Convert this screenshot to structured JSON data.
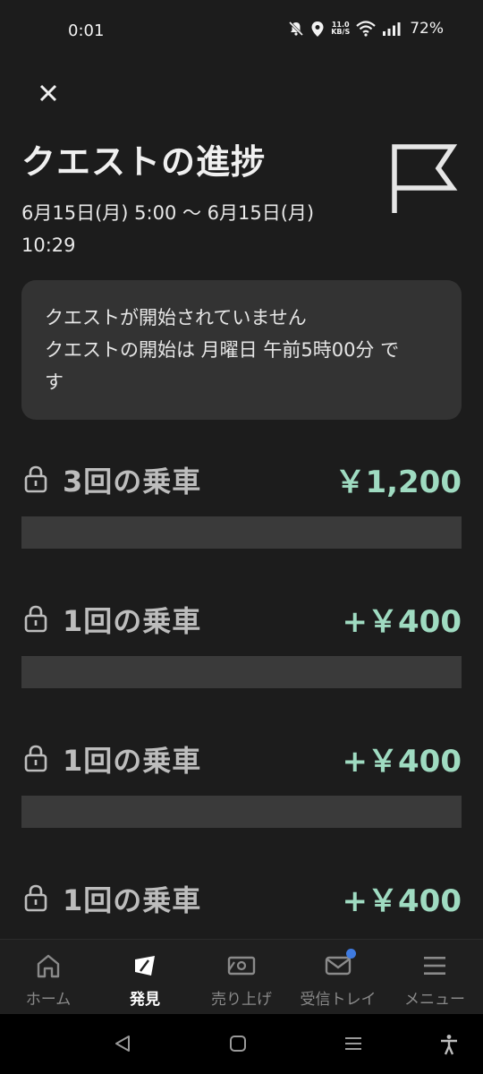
{
  "status_bar": {
    "time": "0:01",
    "net_speed_value": "11.0",
    "net_speed_unit": "KB/S",
    "battery": "72%"
  },
  "header": {
    "title": "クエストの進捗",
    "date_range_line1": "6月15日(月) 5:00 〜 6月15日(月)",
    "date_range_line2": "10:29"
  },
  "notice": {
    "line1": "クエストが開始されていません",
    "line2": "クエストの開始は 月曜日 午前5時00分 で",
    "line3": "す"
  },
  "quests": [
    {
      "label": "3回の乗車",
      "reward": "￥1,200",
      "progress": 0
    },
    {
      "label": "1回の乗車",
      "reward": "+￥400",
      "progress": 0
    },
    {
      "label": "1回の乗車",
      "reward": "+￥400",
      "progress": 0
    },
    {
      "label": "1回の乗車",
      "reward": "+￥400",
      "progress": 0
    }
  ],
  "bottom_nav": {
    "home": "ホーム",
    "discover": "発見",
    "earnings": "売り上げ",
    "inbox": "受信トレイ",
    "menu": "メニュー"
  },
  "colors": {
    "background": "#1c1c1c",
    "card": "#333333",
    "reward_accent": "#9fdbc1",
    "progress_track": "#3a3a3a",
    "badge": "#3f7be0"
  }
}
